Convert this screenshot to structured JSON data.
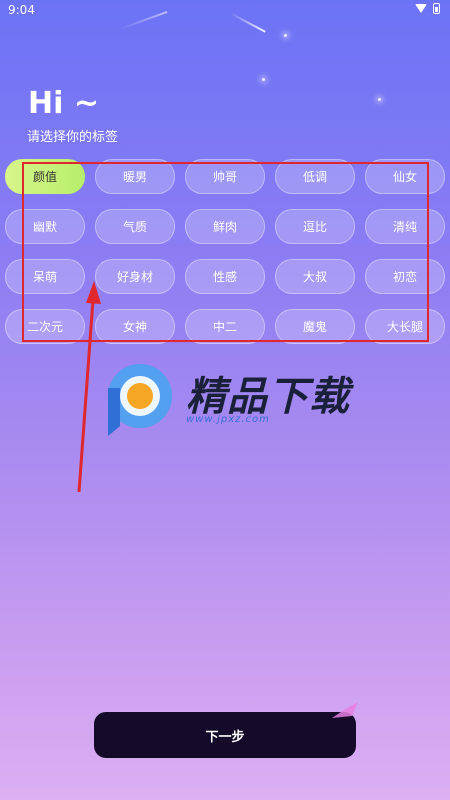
{
  "status_bar": {
    "time": "9:04",
    "icons": [
      "wifi-icon",
      "battery-icon"
    ]
  },
  "header": {
    "greeting": "Hi ~",
    "subtitle": "请选择你的标签"
  },
  "tags": {
    "rows": [
      [
        {
          "label": "颜值",
          "selected": true
        },
        {
          "label": "暖男",
          "selected": false
        },
        {
          "label": "帅哥",
          "selected": false
        },
        {
          "label": "低调",
          "selected": false
        },
        {
          "label": "仙女",
          "selected": false
        }
      ],
      [
        {
          "label": "幽默",
          "selected": false
        },
        {
          "label": "气质",
          "selected": false
        },
        {
          "label": "鲜肉",
          "selected": false
        },
        {
          "label": "逗比",
          "selected": false
        },
        {
          "label": "清纯",
          "selected": false
        }
      ],
      [
        {
          "label": "呆萌",
          "selected": false
        },
        {
          "label": "好身材",
          "selected": false
        },
        {
          "label": "性感",
          "selected": false
        },
        {
          "label": "大叔",
          "selected": false
        },
        {
          "label": "初恋",
          "selected": false
        }
      ],
      [
        {
          "label": "二次元",
          "selected": false
        },
        {
          "label": "女神",
          "selected": false
        },
        {
          "label": "中二",
          "selected": false
        },
        {
          "label": "魔鬼",
          "selected": false
        },
        {
          "label": "大长腿",
          "selected": false
        }
      ]
    ]
  },
  "watermark": {
    "text": "精品下载",
    "url": "www.jpxz.com"
  },
  "footer": {
    "next_label": "下一步"
  },
  "colors": {
    "selected_tag": "#c6f27a",
    "annotation": "#e0272e",
    "button": "#150a2a"
  }
}
